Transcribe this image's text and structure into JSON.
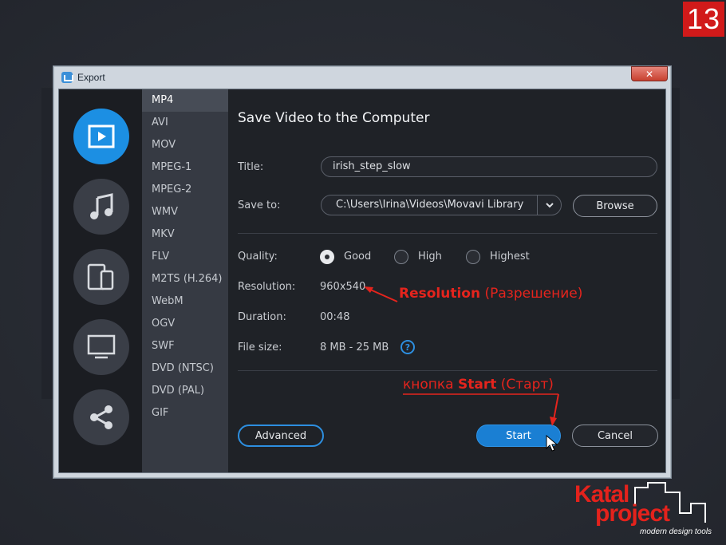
{
  "page": {
    "step_number": "13"
  },
  "window": {
    "title": "Export",
    "close_label": "✕"
  },
  "categories": [
    {
      "icon": "video-icon",
      "active": true
    },
    {
      "icon": "music-icon",
      "active": false
    },
    {
      "icon": "devices-icon",
      "active": false
    },
    {
      "icon": "tv-icon",
      "active": false
    },
    {
      "icon": "share-icon",
      "active": false
    }
  ],
  "formats": [
    "MP4",
    "AVI",
    "MOV",
    "MPEG-1",
    "MPEG-2",
    "WMV",
    "MKV",
    "FLV",
    "M2TS (H.264)",
    "WebM",
    "OGV",
    "SWF",
    "DVD (NTSC)",
    "DVD (PAL)",
    "GIF"
  ],
  "selected_format": "MP4",
  "main": {
    "heading": "Save Video to the Computer",
    "title_label": "Title:",
    "title_value": "irish_step_slow",
    "save_to_label": "Save to:",
    "save_to_value": "C:\\Users\\Irina\\Videos\\Movavi Library",
    "browse_label": "Browse",
    "quality_label": "Quality:",
    "quality_options": [
      "Good",
      "High",
      "Highest"
    ],
    "quality_selected": "Good",
    "resolution_label": "Resolution:",
    "resolution_value": "960x540",
    "duration_label": "Duration:",
    "duration_value": "00:48",
    "filesize_label": "File size:",
    "filesize_value": "8 MB - 25 MB",
    "help_glyph": "?",
    "advanced_label": "Advanced",
    "start_label": "Start",
    "cancel_label": "Cancel"
  },
  "annotations": {
    "resolution_en": "Resolution",
    "resolution_ru": "(Разрешение)",
    "start_prefix": "кнопка",
    "start_en": "Start",
    "start_ru": "(Старт)"
  },
  "logo": {
    "line1": "Katal",
    "line2": "project",
    "tagline": "modern design tools"
  },
  "colors": {
    "accent": "#1c8fe3",
    "annotation": "#e5241d",
    "badge": "#d11a1a"
  }
}
